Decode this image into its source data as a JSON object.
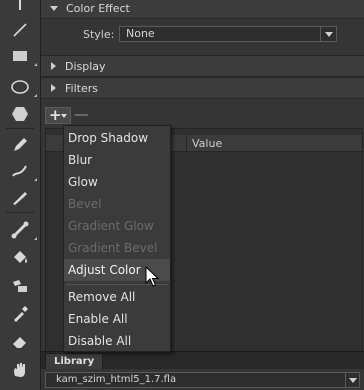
{
  "tools": [
    {
      "name": "text-tool-icon"
    },
    {
      "name": "line-tool-icon"
    },
    {
      "name": "rectangle-tool-icon"
    },
    {
      "name": "oval-tool-icon"
    },
    {
      "name": "polystar-tool-icon"
    },
    {
      "name": "pencil-tool-icon"
    },
    {
      "name": "brush-tool-icon"
    },
    {
      "name": "spray-brush-tool-icon"
    },
    {
      "name": "bone-tool-icon"
    },
    {
      "name": "paint-bucket-tool-icon"
    },
    {
      "name": "ink-bottle-tool-icon"
    },
    {
      "name": "eyedropper-tool-icon"
    },
    {
      "name": "eraser-tool-icon"
    },
    {
      "name": "hand-tool-icon"
    }
  ],
  "color_effect": {
    "title": "Color Effect",
    "style_label": "Style:",
    "style_value": "None"
  },
  "display": {
    "title": "Display"
  },
  "filters": {
    "title": "Filters",
    "add_symbol": "+",
    "remove_symbol": "—",
    "value_header": "Value"
  },
  "menu": {
    "items": [
      {
        "label": "Drop Shadow",
        "enabled": true
      },
      {
        "label": "Blur",
        "enabled": true
      },
      {
        "label": "Glow",
        "enabled": true
      },
      {
        "label": "Bevel",
        "enabled": false
      },
      {
        "label": "Gradient Glow",
        "enabled": false
      },
      {
        "label": "Gradient Bevel",
        "enabled": false
      },
      {
        "label": "Adjust Color",
        "enabled": true,
        "hover": true
      },
      {
        "label": "Remove All",
        "enabled": true
      },
      {
        "label": "Enable All",
        "enabled": true
      },
      {
        "label": "Disable All",
        "enabled": true
      }
    ]
  },
  "library": {
    "tab_label": "Library",
    "document": "kam_szim_html5_1.7.fla"
  },
  "colors": {
    "panel_bg": "#353535",
    "menu_bg": "#3b3b3b",
    "menu_hover": "#4b4b4b",
    "text": "#e4e4e4",
    "disabled_text": "#6b6b6b"
  }
}
